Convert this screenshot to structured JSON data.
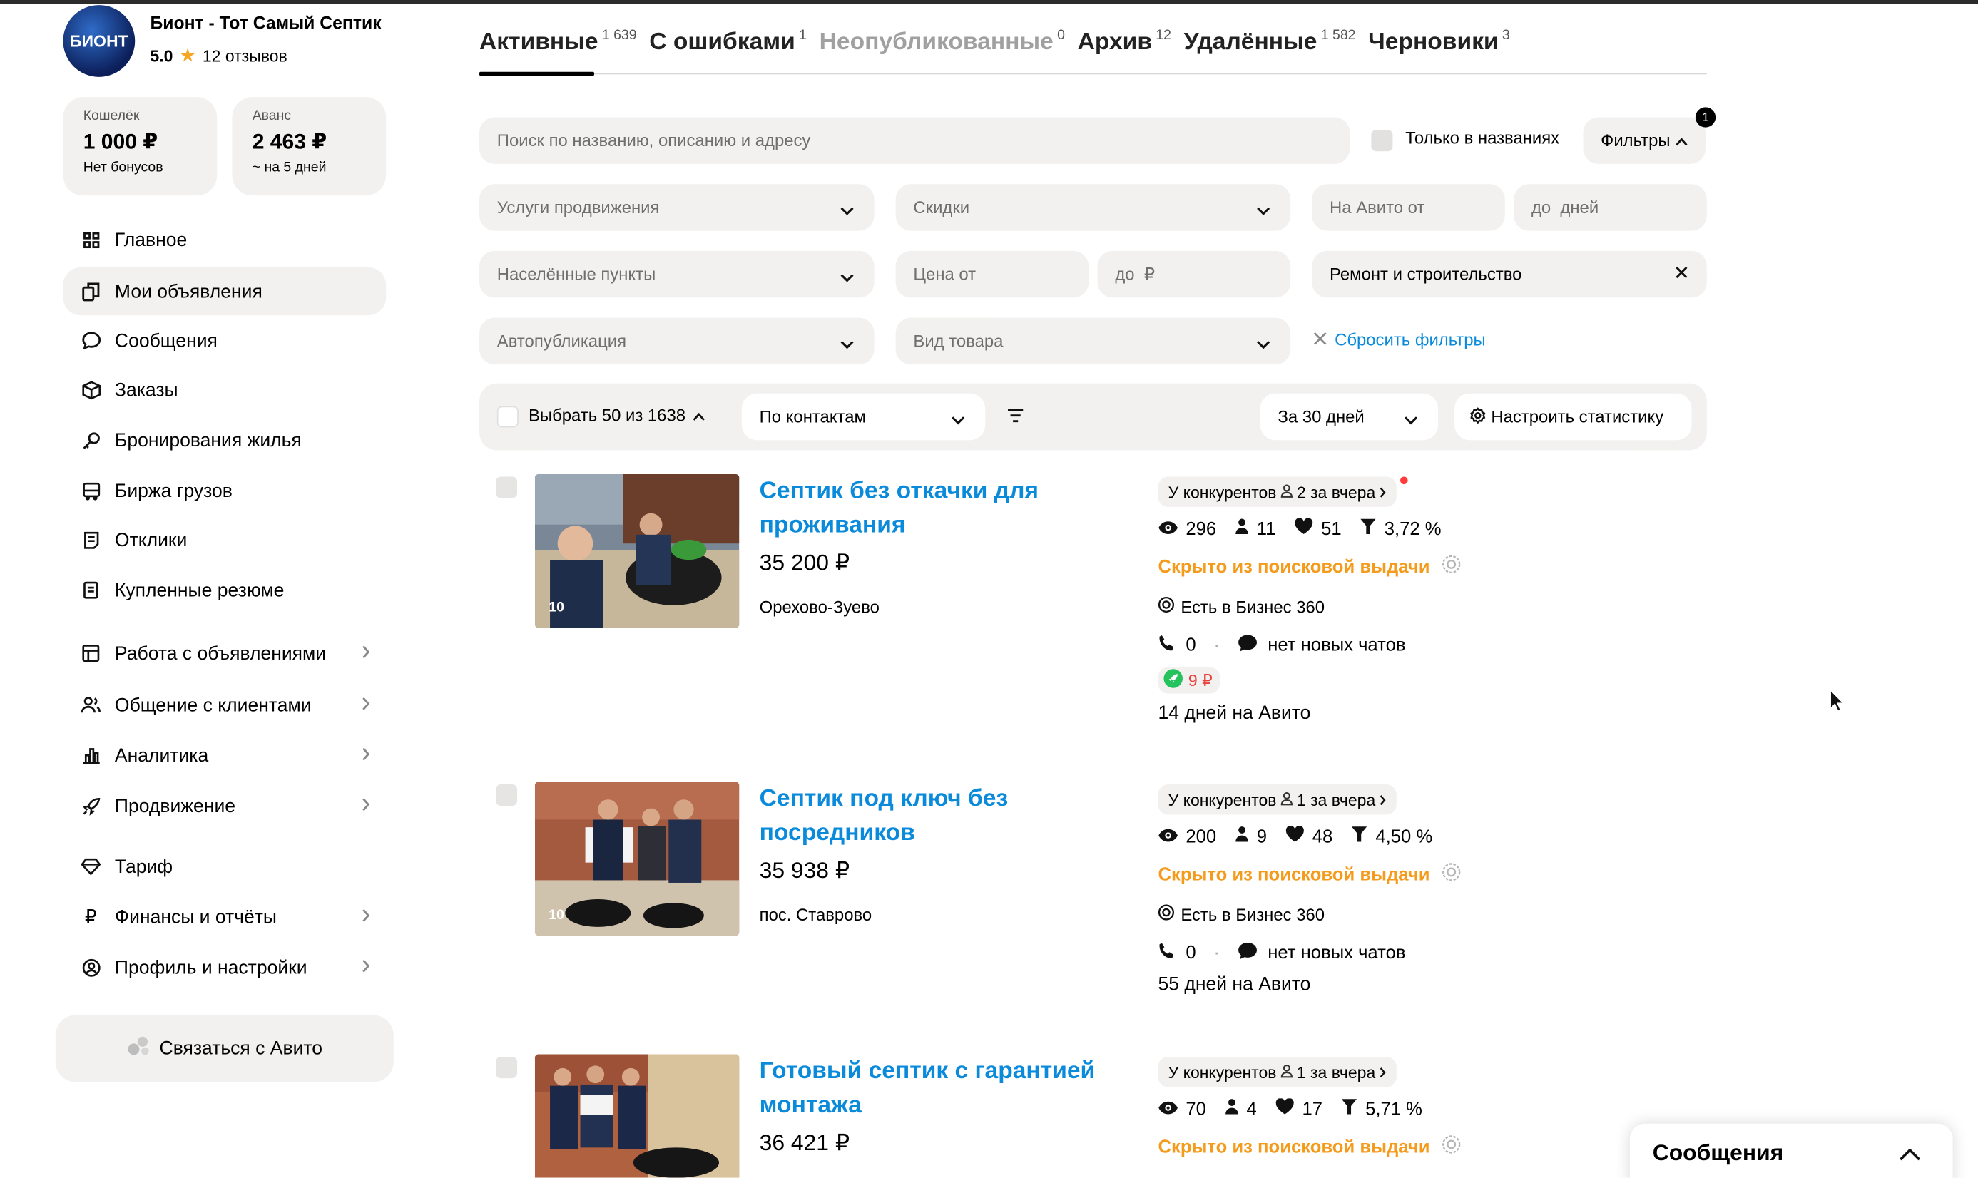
{
  "shop": {
    "name": "Бионт - Тот Самый Септик",
    "rating": "5.0",
    "reviews": "12 отзывов",
    "logo_text": "БИОНТ"
  },
  "wallet": {
    "label": "Кошелёк",
    "value": "1 000 ₽",
    "sub": "Нет бонусов"
  },
  "advance": {
    "label": "Аванс",
    "value": "2 463 ₽",
    "sub": "~ на 5 дней"
  },
  "nav": [
    {
      "label": "Главное",
      "icon": "grid-icon"
    },
    {
      "label": "Мои объявления",
      "icon": "copy-icon",
      "active": true
    },
    {
      "label": "Сообщения",
      "icon": "chat-icon"
    },
    {
      "label": "Заказы",
      "icon": "box-icon"
    },
    {
      "label": "Бронирования жилья",
      "icon": "key-icon"
    },
    {
      "label": "Биржа грузов",
      "icon": "truck-icon"
    },
    {
      "label": "Отклики",
      "icon": "document-icon"
    },
    {
      "label": "Купленные резюме",
      "icon": "resume-icon"
    },
    {
      "label": "Работа с объявлениями",
      "icon": "list-icon"
    },
    {
      "label": "Общение с клиентами",
      "icon": "users-icon"
    },
    {
      "label": "Аналитика",
      "icon": "chart-icon"
    },
    {
      "label": "Продвижение",
      "icon": "rocket-icon"
    },
    {
      "label": "Тариф",
      "icon": "diamond-icon"
    },
    {
      "label": "Финансы и отчёты",
      "icon": "ruble-icon"
    },
    {
      "label": "Профиль и настройки",
      "icon": "profile-icon"
    }
  ],
  "contact_button": "Связаться с Авито",
  "tabs": [
    {
      "label": "Активные",
      "count": "1 639"
    },
    {
      "label": "С ошибками",
      "count": "1"
    },
    {
      "label": "Неопубликованные",
      "count": "0"
    },
    {
      "label": "Архив",
      "count": "12"
    },
    {
      "label": "Удалённые",
      "count": "1 582"
    },
    {
      "label": "Черновики",
      "count": "3"
    }
  ],
  "search": {
    "placeholder": "Поиск по названию, описанию и адресу",
    "only_titles": "Только в названиях",
    "filters": "Фильтры",
    "filters_count": "1"
  },
  "filters": {
    "promotion": "Услуги продвижения",
    "discounts": "Скидки",
    "on_avito_from": "На Авито от",
    "to_days": "до  дней",
    "localities": "Населённые пункты",
    "price_from": "Цена от",
    "price_to": "до  ₽",
    "category": "Ремонт и строительство",
    "autopublish": "Автопубликация",
    "product_type": "Вид товара",
    "reset": "Сбросить фильтры"
  },
  "toolbar": {
    "select": "Выбрать 50 из 1638",
    "sort": "По контактам",
    "period": "За 30 дней",
    "configure": "Настроить статистику"
  },
  "listings": [
    {
      "title": "Септик без откачки для проживания",
      "price": "35 200 ₽",
      "location": "Орехово-Зуево",
      "photos": "10",
      "competitors": "У конкурентов",
      "competitors_yesterday": "2 за вчера",
      "views": "296",
      "contacts": "11",
      "favorites": "51",
      "conversion": "3,72 %",
      "hidden": "Скрыто из поисковой выдачи",
      "business": "Есть в Бизнес 360",
      "calls": "0",
      "chats": "нет новых чатов",
      "promo": "9 ₽",
      "days": "14 дней на Авито"
    },
    {
      "title": "Септик под ключ без посредников",
      "price": "35 938 ₽",
      "location": "пос. Ставрово",
      "photos": "10",
      "competitors": "У конкурентов",
      "competitors_yesterday": "1 за вчера",
      "views": "200",
      "contacts": "9",
      "favorites": "48",
      "conversion": "4,50 %",
      "hidden": "Скрыто из поисковой выдачи",
      "business": "Есть в Бизнес 360",
      "calls": "0",
      "chats": "нет новых чатов",
      "days": "55 дней на Авито"
    },
    {
      "title": "Готовый септик с гарантией монтажа",
      "price": "36 421 ₽",
      "competitors": "У конкурентов",
      "competitors_yesterday": "1 за вчера",
      "views": "70",
      "contacts": "4",
      "favorites": "17",
      "conversion": "5,71 %",
      "hidden": "Скрыто из поисковой выдачи"
    }
  ],
  "messages_panel": "Сообщения"
}
